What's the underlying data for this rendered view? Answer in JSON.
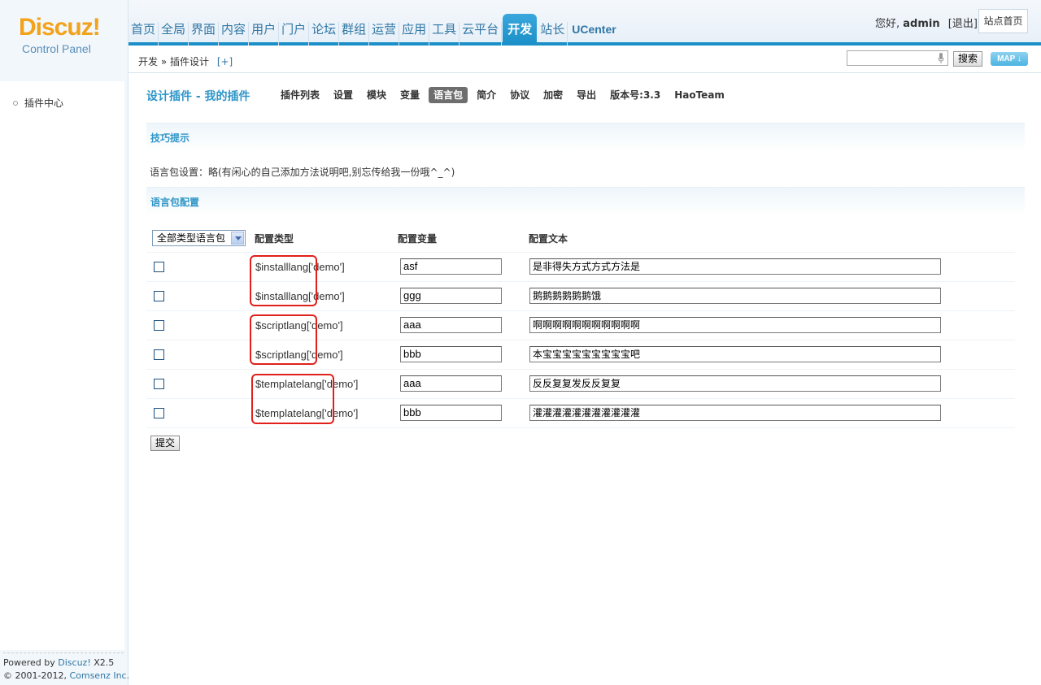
{
  "header": {
    "logo_main": "Discuz!",
    "logo_sub": "Control Panel",
    "nav": [
      {
        "label": "首页",
        "active": false
      },
      {
        "label": "全局",
        "active": false
      },
      {
        "label": "界面",
        "active": false
      },
      {
        "label": "内容",
        "active": false
      },
      {
        "label": "用户",
        "active": false
      },
      {
        "label": "门户",
        "active": false
      },
      {
        "label": "论坛",
        "active": false
      },
      {
        "label": "群组",
        "active": false
      },
      {
        "label": "运营",
        "active": false
      },
      {
        "label": "应用",
        "active": false
      },
      {
        "label": "工具",
        "active": false
      },
      {
        "label": "云平台",
        "active": false
      },
      {
        "label": "开发",
        "active": true
      },
      {
        "label": "站长",
        "active": false
      },
      {
        "label": "UCenter",
        "active": false
      }
    ],
    "greeting": "您好,",
    "username": "admin",
    "logout": "[退出]",
    "site_home": "站点首页"
  },
  "subheader": {
    "breadcrumb": "开发 » 插件设计",
    "add": "[+]",
    "search_value": "",
    "search_btn": "搜索",
    "map_btn": "MAP ↓"
  },
  "sidebar": {
    "items": [
      "插件中心"
    ]
  },
  "footer": {
    "powered_prefix": "Powered by",
    "brand": "Discuz!",
    "version": "X2.5",
    "copyright": "© 2001-2012,",
    "company": "Comsenz Inc."
  },
  "main": {
    "title": "设计插件 - 我的插件",
    "tabs": [
      {
        "label": "插件列表",
        "active": false
      },
      {
        "label": "设置",
        "active": false
      },
      {
        "label": "模块",
        "active": false
      },
      {
        "label": "变量",
        "active": false
      },
      {
        "label": "语言包",
        "active": true
      },
      {
        "label": "简介",
        "active": false
      },
      {
        "label": "协议",
        "active": false
      },
      {
        "label": "加密",
        "active": false
      },
      {
        "label": "导出",
        "active": false
      },
      {
        "label": "版本号:3.3",
        "active": false
      },
      {
        "label": "HaoTeam",
        "active": false
      }
    ],
    "tip_header": "技巧提示",
    "tip_text": "语言包设置：略(有闲心的自己添加方法说明吧,别忘传给我一份哦^_^)",
    "config_header": "语言包配置",
    "select_value": "全部类型语言包",
    "columns": [
      "配置类型",
      "配置变量",
      "配置文本"
    ],
    "rows": [
      {
        "prefix": "$installlang",
        "suffix": "['demo']",
        "var": "asf",
        "text": "是非得失方式方式方法是"
      },
      {
        "prefix": "$installlang",
        "suffix": "['demo']",
        "var": "ggg",
        "text": "鹅鹅鹅鹅鹅鹅饿"
      },
      {
        "prefix": "$scriptlang",
        "suffix": "['demo']",
        "var": "aaa",
        "text": "啊啊啊啊啊啊啊啊啊啊啊"
      },
      {
        "prefix": "$scriptlang",
        "suffix": "['demo']",
        "var": "bbb",
        "text": "本宝宝宝宝宝宝宝宝宝吧"
      },
      {
        "prefix": "$templatelang",
        "suffix": "['demo']",
        "var": "aaa",
        "text": "反反复复发反反复复"
      },
      {
        "prefix": "$templatelang",
        "suffix": "['demo']",
        "var": "bbb",
        "text": "灌灌灌灌灌灌灌灌灌灌灌"
      }
    ],
    "submit": "提交"
  },
  "colors": {
    "accent": "#1a8fc8",
    "logo": "#f2a21b",
    "highlight": "#e0201a"
  }
}
